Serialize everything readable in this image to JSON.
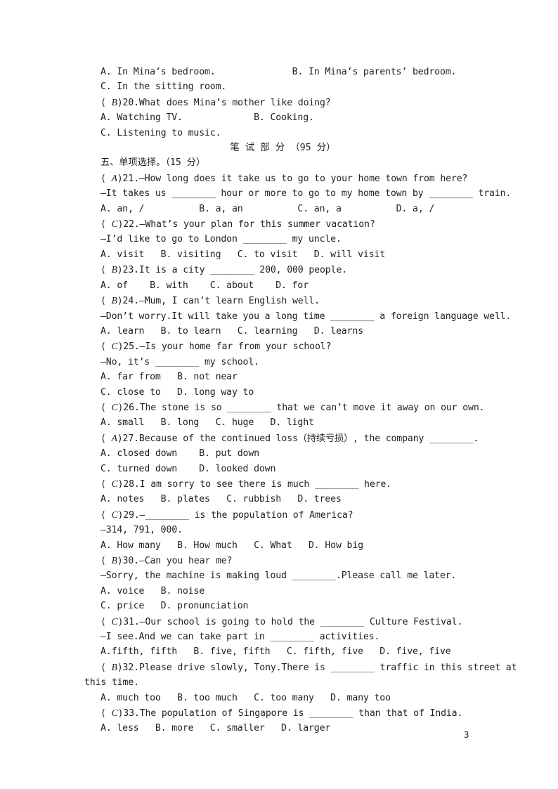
{
  "page": {
    "number": "3"
  },
  "listening_tail": {
    "q19_options_line1": "A. In Mina’s bedroom.              B. In Mina’s parents’ bedroom.",
    "q19_options_line2": "C. In the sitting room.",
    "q20_key": "B",
    "q20_prompt": ")20.What does Mina’s mother like doing?",
    "q20_options_line1": "A. Watching TV.             B. Cooking.",
    "q20_options_line2": "C. Listening to music."
  },
  "written_part": {
    "title": "笔 试 部 分 （95 分）",
    "section_heading": "五、单项选择。（15 分）"
  },
  "questions": [
    {
      "key": "A",
      "stem": ")21.—How long does it take us to go to your home town from here?",
      "lines": [
        "—It takes us ________ hour or more to go to my home town by ________ train.",
        "A. an, /          B. a, an          C. an, a          D. a, /"
      ]
    },
    {
      "key": "C",
      "stem": ")22.—What’s your plan for this summer vacation?",
      "lines": [
        "—I’d like to go to London ________ my uncle.",
        "A. visit   B. visiting   C. to visit   D. will visit"
      ]
    },
    {
      "key": "B",
      "stem": ")23.It is a city ________ 200, 000 people.",
      "lines": [
        "A. of    B. with    C. about    D. for"
      ]
    },
    {
      "key": "B",
      "stem": ")24.—Mum, I can’t learn English well.",
      "lines": [
        "—Don’t worry.It will take you a long time ________ a foreign language well.",
        "A. learn   B. to learn   C. learning   D. learns"
      ]
    },
    {
      "key": "C",
      "stem": ")25.—Is your home far from your school?",
      "lines": [
        "—No, it’s ________ my school.",
        "A. far from   B. not near",
        "C. close to   D. long way to"
      ]
    },
    {
      "key": "C",
      "stem": ")26.The stone is so ________ that we can’t move it away on our own.",
      "lines": [
        "A. small   B. long   C. huge   D. light"
      ]
    },
    {
      "key": "A",
      "stem": ")27.Because of the continued loss（持续亏损）, the company ________.",
      "lines": [
        "A. closed down    B. put down",
        "C. turned down    D. looked down"
      ]
    },
    {
      "key": "C",
      "stem": ")28.I am sorry to see there is much ________ here.",
      "lines": [
        "A. notes   B. plates   C. rubbish   D. trees"
      ]
    },
    {
      "key": "C",
      "stem": ")29.—________ is the population of America?",
      "lines": [
        "—314, 791, 000.",
        "A. How many   B. How much   C. What   D. How big"
      ]
    },
    {
      "key": "B",
      "stem": ")30.—Can you hear me?",
      "lines": [
        "—Sorry, the machine is making loud ________.Please call me later.",
        "A. voice   B. noise",
        "C. price   D. pronunciation"
      ]
    },
    {
      "key": "C",
      "stem": ")31.—Our school is going to hold the ________ Culture Festival.",
      "lines": [
        "—I see.And we can take part in ________ activities.",
        "A.fifth, fifth   B. five, fifth   C. fifth, five   D. five, five"
      ]
    },
    {
      "key": "B",
      "stem": ")32.Please drive slowly, Tony.There is ________ traffic in this street at",
      "lines_flush": [
        "this time."
      ],
      "lines": [
        "A. much too   B. too much   C. too many   D. many too"
      ]
    },
    {
      "key": "C",
      "stem": ")33.The population of Singapore is ________ than that of India.",
      "lines": [
        "A. less   B. more   C. smaller   D. larger"
      ]
    }
  ]
}
